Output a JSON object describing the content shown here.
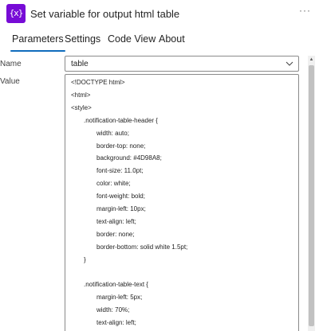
{
  "header": {
    "icon_text": "{x}",
    "title": "Set variable for output html table",
    "more": "···"
  },
  "tabs": [
    {
      "label": "Parameters"
    },
    {
      "label": "Settings"
    },
    {
      "label": "Code View"
    },
    {
      "label": "About"
    }
  ],
  "active_tab": "Parameters",
  "fields": {
    "name_label": "Name",
    "name_value": "table",
    "value_label": "Value"
  },
  "value_lines": [
    "<!DOCTYPE html>",
    "<html>",
    "<style>",
    ".notification-table-header {",
    "width: auto;",
    "border-top: none;",
    "background: #4D98A8;",
    "font-size: 11.0pt;",
    "color: white;",
    "font-weight: bold;",
    "margin-left: 10px;",
    "text-align: left;",
    "border: none;",
    "border-bottom: solid white 1.5pt;",
    "}",
    "",
    ".notification-table-text {",
    "margin-left: 5px;",
    "width: 70%;",
    "text-align: left;",
    "border: none;"
  ],
  "colors": {
    "accent": "#0f6cbd",
    "action_icon": "#770bd6"
  }
}
